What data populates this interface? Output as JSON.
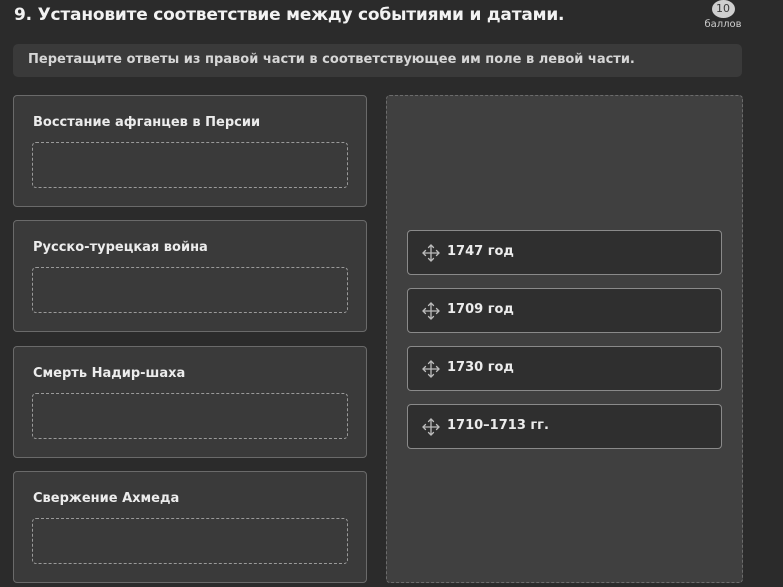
{
  "question": {
    "title": "9. Установите соответствие между событиями и датами.",
    "points_value": "10",
    "points_label": "баллов"
  },
  "instruction": "Перетащите ответы из правой части в соответствующее им поле в левой части.",
  "events": [
    {
      "label": "Восстание афганцев в Персии"
    },
    {
      "label": "Русско-турецкая война"
    },
    {
      "label": "Смерть Надир-шаха"
    },
    {
      "label": "Свержение Ахмеда"
    }
  ],
  "answers": [
    {
      "label": "1747 год",
      "icon": "move-icon"
    },
    {
      "label": "1709 год",
      "icon": "move-icon"
    },
    {
      "label": "1730 год",
      "icon": "move-icon"
    },
    {
      "label": "1710–1713 гг.",
      "icon": "move-icon"
    }
  ]
}
